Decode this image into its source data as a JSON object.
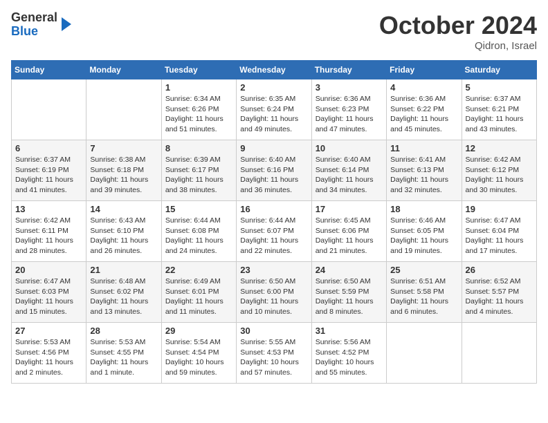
{
  "header": {
    "logo_general": "General",
    "logo_blue": "Blue",
    "month": "October 2024",
    "location": "Qidron, Israel"
  },
  "days_of_week": [
    "Sunday",
    "Monday",
    "Tuesday",
    "Wednesday",
    "Thursday",
    "Friday",
    "Saturday"
  ],
  "weeks": [
    [
      {
        "num": "",
        "info": ""
      },
      {
        "num": "",
        "info": ""
      },
      {
        "num": "1",
        "info": "Sunrise: 6:34 AM\nSunset: 6:26 PM\nDaylight: 11 hours and 51 minutes."
      },
      {
        "num": "2",
        "info": "Sunrise: 6:35 AM\nSunset: 6:24 PM\nDaylight: 11 hours and 49 minutes."
      },
      {
        "num": "3",
        "info": "Sunrise: 6:36 AM\nSunset: 6:23 PM\nDaylight: 11 hours and 47 minutes."
      },
      {
        "num": "4",
        "info": "Sunrise: 6:36 AM\nSunset: 6:22 PM\nDaylight: 11 hours and 45 minutes."
      },
      {
        "num": "5",
        "info": "Sunrise: 6:37 AM\nSunset: 6:21 PM\nDaylight: 11 hours and 43 minutes."
      }
    ],
    [
      {
        "num": "6",
        "info": "Sunrise: 6:37 AM\nSunset: 6:19 PM\nDaylight: 11 hours and 41 minutes."
      },
      {
        "num": "7",
        "info": "Sunrise: 6:38 AM\nSunset: 6:18 PM\nDaylight: 11 hours and 39 minutes."
      },
      {
        "num": "8",
        "info": "Sunrise: 6:39 AM\nSunset: 6:17 PM\nDaylight: 11 hours and 38 minutes."
      },
      {
        "num": "9",
        "info": "Sunrise: 6:40 AM\nSunset: 6:16 PM\nDaylight: 11 hours and 36 minutes."
      },
      {
        "num": "10",
        "info": "Sunrise: 6:40 AM\nSunset: 6:14 PM\nDaylight: 11 hours and 34 minutes."
      },
      {
        "num": "11",
        "info": "Sunrise: 6:41 AM\nSunset: 6:13 PM\nDaylight: 11 hours and 32 minutes."
      },
      {
        "num": "12",
        "info": "Sunrise: 6:42 AM\nSunset: 6:12 PM\nDaylight: 11 hours and 30 minutes."
      }
    ],
    [
      {
        "num": "13",
        "info": "Sunrise: 6:42 AM\nSunset: 6:11 PM\nDaylight: 11 hours and 28 minutes."
      },
      {
        "num": "14",
        "info": "Sunrise: 6:43 AM\nSunset: 6:10 PM\nDaylight: 11 hours and 26 minutes."
      },
      {
        "num": "15",
        "info": "Sunrise: 6:44 AM\nSunset: 6:08 PM\nDaylight: 11 hours and 24 minutes."
      },
      {
        "num": "16",
        "info": "Sunrise: 6:44 AM\nSunset: 6:07 PM\nDaylight: 11 hours and 22 minutes."
      },
      {
        "num": "17",
        "info": "Sunrise: 6:45 AM\nSunset: 6:06 PM\nDaylight: 11 hours and 21 minutes."
      },
      {
        "num": "18",
        "info": "Sunrise: 6:46 AM\nSunset: 6:05 PM\nDaylight: 11 hours and 19 minutes."
      },
      {
        "num": "19",
        "info": "Sunrise: 6:47 AM\nSunset: 6:04 PM\nDaylight: 11 hours and 17 minutes."
      }
    ],
    [
      {
        "num": "20",
        "info": "Sunrise: 6:47 AM\nSunset: 6:03 PM\nDaylight: 11 hours and 15 minutes."
      },
      {
        "num": "21",
        "info": "Sunrise: 6:48 AM\nSunset: 6:02 PM\nDaylight: 11 hours and 13 minutes."
      },
      {
        "num": "22",
        "info": "Sunrise: 6:49 AM\nSunset: 6:01 PM\nDaylight: 11 hours and 11 minutes."
      },
      {
        "num": "23",
        "info": "Sunrise: 6:50 AM\nSunset: 6:00 PM\nDaylight: 11 hours and 10 minutes."
      },
      {
        "num": "24",
        "info": "Sunrise: 6:50 AM\nSunset: 5:59 PM\nDaylight: 11 hours and 8 minutes."
      },
      {
        "num": "25",
        "info": "Sunrise: 6:51 AM\nSunset: 5:58 PM\nDaylight: 11 hours and 6 minutes."
      },
      {
        "num": "26",
        "info": "Sunrise: 6:52 AM\nSunset: 5:57 PM\nDaylight: 11 hours and 4 minutes."
      }
    ],
    [
      {
        "num": "27",
        "info": "Sunrise: 5:53 AM\nSunset: 4:56 PM\nDaylight: 11 hours and 2 minutes."
      },
      {
        "num": "28",
        "info": "Sunrise: 5:53 AM\nSunset: 4:55 PM\nDaylight: 11 hours and 1 minute."
      },
      {
        "num": "29",
        "info": "Sunrise: 5:54 AM\nSunset: 4:54 PM\nDaylight: 10 hours and 59 minutes."
      },
      {
        "num": "30",
        "info": "Sunrise: 5:55 AM\nSunset: 4:53 PM\nDaylight: 10 hours and 57 minutes."
      },
      {
        "num": "31",
        "info": "Sunrise: 5:56 AM\nSunset: 4:52 PM\nDaylight: 10 hours and 55 minutes."
      },
      {
        "num": "",
        "info": ""
      },
      {
        "num": "",
        "info": ""
      }
    ]
  ]
}
